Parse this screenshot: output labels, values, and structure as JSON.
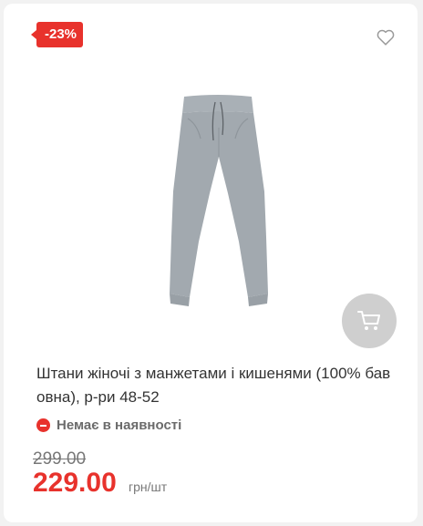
{
  "colors": {
    "accent": "#e8322c",
    "card_bg": "#ffffff",
    "page_bg": "#f2f2f2",
    "cart_button_bg": "#cfcfcf"
  },
  "product": {
    "discount_badge": "-23%",
    "title": "Штани жіночі з манжетами і кишенями (100% бавовна), р-ри 48-52",
    "stock_status": "Немає в наявності",
    "old_price": "299.00",
    "price": "229.00",
    "price_unit": "грн/шт",
    "icons": {
      "favorite": "heart-icon",
      "cart": "cart-icon",
      "stock": "minus-circle-icon"
    }
  }
}
